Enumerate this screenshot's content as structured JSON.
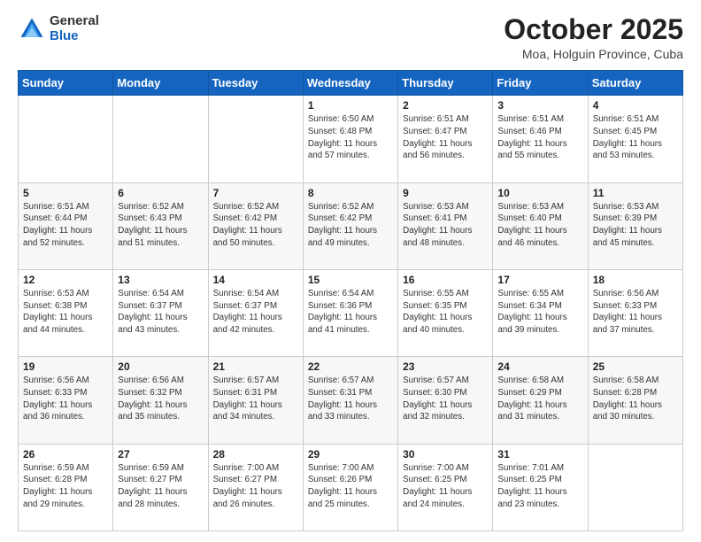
{
  "header": {
    "logo_general": "General",
    "logo_blue": "Blue",
    "month_title": "October 2025",
    "location": "Moa, Holguin Province, Cuba"
  },
  "weekdays": [
    "Sunday",
    "Monday",
    "Tuesday",
    "Wednesday",
    "Thursday",
    "Friday",
    "Saturday"
  ],
  "weeks": [
    [
      {
        "day": "",
        "sunrise": "",
        "sunset": "",
        "daylight": ""
      },
      {
        "day": "",
        "sunrise": "",
        "sunset": "",
        "daylight": ""
      },
      {
        "day": "",
        "sunrise": "",
        "sunset": "",
        "daylight": ""
      },
      {
        "day": "1",
        "sunrise": "Sunrise: 6:50 AM",
        "sunset": "Sunset: 6:48 PM",
        "daylight": "Daylight: 11 hours and 57 minutes."
      },
      {
        "day": "2",
        "sunrise": "Sunrise: 6:51 AM",
        "sunset": "Sunset: 6:47 PM",
        "daylight": "Daylight: 11 hours and 56 minutes."
      },
      {
        "day": "3",
        "sunrise": "Sunrise: 6:51 AM",
        "sunset": "Sunset: 6:46 PM",
        "daylight": "Daylight: 11 hours and 55 minutes."
      },
      {
        "day": "4",
        "sunrise": "Sunrise: 6:51 AM",
        "sunset": "Sunset: 6:45 PM",
        "daylight": "Daylight: 11 hours and 53 minutes."
      }
    ],
    [
      {
        "day": "5",
        "sunrise": "Sunrise: 6:51 AM",
        "sunset": "Sunset: 6:44 PM",
        "daylight": "Daylight: 11 hours and 52 minutes."
      },
      {
        "day": "6",
        "sunrise": "Sunrise: 6:52 AM",
        "sunset": "Sunset: 6:43 PM",
        "daylight": "Daylight: 11 hours and 51 minutes."
      },
      {
        "day": "7",
        "sunrise": "Sunrise: 6:52 AM",
        "sunset": "Sunset: 6:42 PM",
        "daylight": "Daylight: 11 hours and 50 minutes."
      },
      {
        "day": "8",
        "sunrise": "Sunrise: 6:52 AM",
        "sunset": "Sunset: 6:42 PM",
        "daylight": "Daylight: 11 hours and 49 minutes."
      },
      {
        "day": "9",
        "sunrise": "Sunrise: 6:53 AM",
        "sunset": "Sunset: 6:41 PM",
        "daylight": "Daylight: 11 hours and 48 minutes."
      },
      {
        "day": "10",
        "sunrise": "Sunrise: 6:53 AM",
        "sunset": "Sunset: 6:40 PM",
        "daylight": "Daylight: 11 hours and 46 minutes."
      },
      {
        "day": "11",
        "sunrise": "Sunrise: 6:53 AM",
        "sunset": "Sunset: 6:39 PM",
        "daylight": "Daylight: 11 hours and 45 minutes."
      }
    ],
    [
      {
        "day": "12",
        "sunrise": "Sunrise: 6:53 AM",
        "sunset": "Sunset: 6:38 PM",
        "daylight": "Daylight: 11 hours and 44 minutes."
      },
      {
        "day": "13",
        "sunrise": "Sunrise: 6:54 AM",
        "sunset": "Sunset: 6:37 PM",
        "daylight": "Daylight: 11 hours and 43 minutes."
      },
      {
        "day": "14",
        "sunrise": "Sunrise: 6:54 AM",
        "sunset": "Sunset: 6:37 PM",
        "daylight": "Daylight: 11 hours and 42 minutes."
      },
      {
        "day": "15",
        "sunrise": "Sunrise: 6:54 AM",
        "sunset": "Sunset: 6:36 PM",
        "daylight": "Daylight: 11 hours and 41 minutes."
      },
      {
        "day": "16",
        "sunrise": "Sunrise: 6:55 AM",
        "sunset": "Sunset: 6:35 PM",
        "daylight": "Daylight: 11 hours and 40 minutes."
      },
      {
        "day": "17",
        "sunrise": "Sunrise: 6:55 AM",
        "sunset": "Sunset: 6:34 PM",
        "daylight": "Daylight: 11 hours and 39 minutes."
      },
      {
        "day": "18",
        "sunrise": "Sunrise: 6:56 AM",
        "sunset": "Sunset: 6:33 PM",
        "daylight": "Daylight: 11 hours and 37 minutes."
      }
    ],
    [
      {
        "day": "19",
        "sunrise": "Sunrise: 6:56 AM",
        "sunset": "Sunset: 6:33 PM",
        "daylight": "Daylight: 11 hours and 36 minutes."
      },
      {
        "day": "20",
        "sunrise": "Sunrise: 6:56 AM",
        "sunset": "Sunset: 6:32 PM",
        "daylight": "Daylight: 11 hours and 35 minutes."
      },
      {
        "day": "21",
        "sunrise": "Sunrise: 6:57 AM",
        "sunset": "Sunset: 6:31 PM",
        "daylight": "Daylight: 11 hours and 34 minutes."
      },
      {
        "day": "22",
        "sunrise": "Sunrise: 6:57 AM",
        "sunset": "Sunset: 6:31 PM",
        "daylight": "Daylight: 11 hours and 33 minutes."
      },
      {
        "day": "23",
        "sunrise": "Sunrise: 6:57 AM",
        "sunset": "Sunset: 6:30 PM",
        "daylight": "Daylight: 11 hours and 32 minutes."
      },
      {
        "day": "24",
        "sunrise": "Sunrise: 6:58 AM",
        "sunset": "Sunset: 6:29 PM",
        "daylight": "Daylight: 11 hours and 31 minutes."
      },
      {
        "day": "25",
        "sunrise": "Sunrise: 6:58 AM",
        "sunset": "Sunset: 6:28 PM",
        "daylight": "Daylight: 11 hours and 30 minutes."
      }
    ],
    [
      {
        "day": "26",
        "sunrise": "Sunrise: 6:59 AM",
        "sunset": "Sunset: 6:28 PM",
        "daylight": "Daylight: 11 hours and 29 minutes."
      },
      {
        "day": "27",
        "sunrise": "Sunrise: 6:59 AM",
        "sunset": "Sunset: 6:27 PM",
        "daylight": "Daylight: 11 hours and 28 minutes."
      },
      {
        "day": "28",
        "sunrise": "Sunrise: 7:00 AM",
        "sunset": "Sunset: 6:27 PM",
        "daylight": "Daylight: 11 hours and 26 minutes."
      },
      {
        "day": "29",
        "sunrise": "Sunrise: 7:00 AM",
        "sunset": "Sunset: 6:26 PM",
        "daylight": "Daylight: 11 hours and 25 minutes."
      },
      {
        "day": "30",
        "sunrise": "Sunrise: 7:00 AM",
        "sunset": "Sunset: 6:25 PM",
        "daylight": "Daylight: 11 hours and 24 minutes."
      },
      {
        "day": "31",
        "sunrise": "Sunrise: 7:01 AM",
        "sunset": "Sunset: 6:25 PM",
        "daylight": "Daylight: 11 hours and 23 minutes."
      },
      {
        "day": "",
        "sunrise": "",
        "sunset": "",
        "daylight": ""
      }
    ]
  ]
}
